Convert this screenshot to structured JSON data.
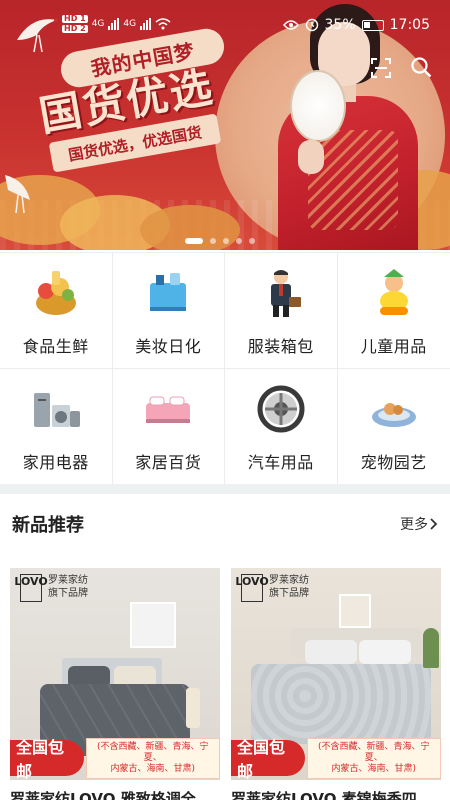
{
  "status_bar": {
    "sim1": "HD 1",
    "net1": "4G",
    "sim2": "HD 2",
    "net2": "4G",
    "battery": "35%",
    "time": "17:05"
  },
  "banner": {
    "tag": "我的中国梦",
    "headline": "国货优选",
    "subline": "国货优选，优选国货",
    "slide_count": 5,
    "active_slide": 1
  },
  "categories": [
    {
      "label": "食品生鲜",
      "icon": "food-basket-icon"
    },
    {
      "label": "美妆日化",
      "icon": "cosmetics-icon"
    },
    {
      "label": "服装箱包",
      "icon": "businessman-bag-icon"
    },
    {
      "label": "儿童用品",
      "icon": "kids-toy-icon"
    },
    {
      "label": "家用电器",
      "icon": "appliances-icon"
    },
    {
      "label": "家居百货",
      "icon": "bed-icon"
    },
    {
      "label": "汽车用品",
      "icon": "steering-wheel-icon"
    },
    {
      "label": "宠物园艺",
      "icon": "pet-bed-icon"
    }
  ],
  "section": {
    "title": "新品推荐",
    "more": "更多"
  },
  "products": [
    {
      "brand_logo": "LOVO",
      "brand_line1": "罗莱家纺",
      "brand_line2": "旗下品牌",
      "promo": "全国包邮",
      "promo_note_line1": "(不含西藏、新疆、青海、宁夏、",
      "promo_note_line2": "内蒙古、海南、甘肃)",
      "name": "罗莱家纺LOVO 雅致格调全"
    },
    {
      "brand_logo": "LOVO",
      "brand_line1": "罗莱家纺",
      "brand_line2": "旗下品牌",
      "promo": "全国包邮",
      "promo_note_line1": "(不含西藏、新疆、青海、宁夏、",
      "promo_note_line2": "内蒙古、海南、甘肃)",
      "name": "罗莱家纺LOVO 素锦梅香四"
    }
  ],
  "colors": {
    "banner_red": "#c9322f",
    "promo_red": "#d62a2a",
    "divider": "#eef1f1"
  }
}
